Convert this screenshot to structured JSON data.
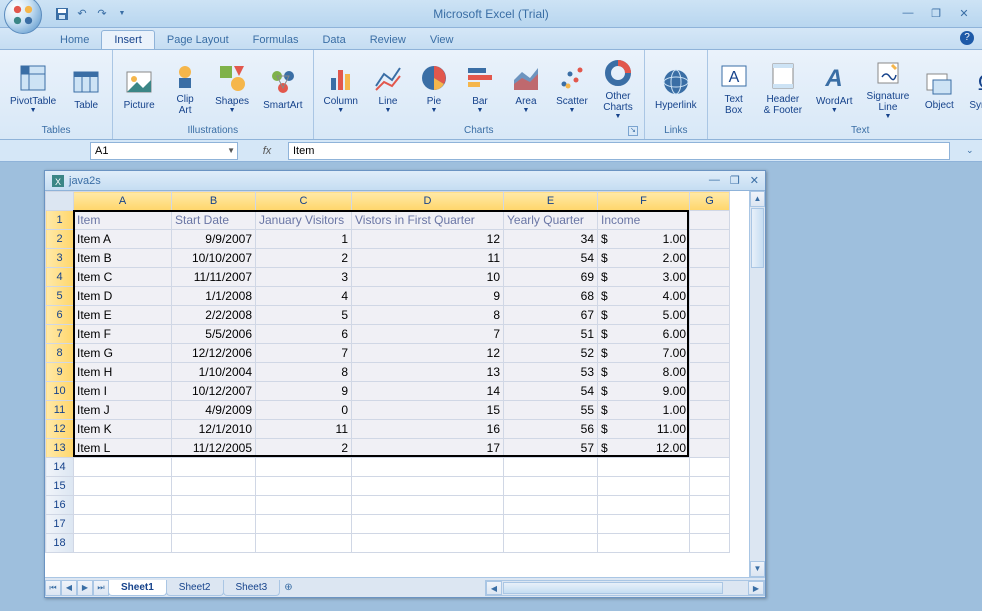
{
  "app": {
    "title": "Microsoft Excel (Trial)"
  },
  "qat": {
    "save": "save-icon",
    "undo": "undo-icon",
    "redo": "redo-icon"
  },
  "tabs": [
    "Home",
    "Insert",
    "Page Layout",
    "Formulas",
    "Data",
    "Review",
    "View"
  ],
  "active_tab": "Insert",
  "ribbon": {
    "groups": [
      {
        "label": "Tables",
        "items": [
          {
            "name": "pivottable",
            "label": "PivotTable",
            "dd": true
          },
          {
            "name": "table",
            "label": "Table"
          }
        ]
      },
      {
        "label": "Illustrations",
        "launcher": false,
        "items": [
          {
            "name": "picture",
            "label": "Picture"
          },
          {
            "name": "clipart",
            "label": "Clip\nArt"
          },
          {
            "name": "shapes",
            "label": "Shapes",
            "dd": true
          },
          {
            "name": "smartart",
            "label": "SmartArt"
          }
        ]
      },
      {
        "label": "Charts",
        "launcher": true,
        "items": [
          {
            "name": "column",
            "label": "Column",
            "dd": true
          },
          {
            "name": "line",
            "label": "Line",
            "dd": true
          },
          {
            "name": "pie",
            "label": "Pie",
            "dd": true
          },
          {
            "name": "bar",
            "label": "Bar",
            "dd": true
          },
          {
            "name": "area",
            "label": "Area",
            "dd": true
          },
          {
            "name": "scatter",
            "label": "Scatter",
            "dd": true
          },
          {
            "name": "othercharts",
            "label": "Other\nCharts",
            "dd": true
          }
        ]
      },
      {
        "label": "Links",
        "items": [
          {
            "name": "hyperlink",
            "label": "Hyperlink"
          }
        ]
      },
      {
        "label": "Text",
        "items": [
          {
            "name": "textbox",
            "label": "Text\nBox"
          },
          {
            "name": "headerfooter",
            "label": "Header\n& Footer"
          },
          {
            "name": "wordart",
            "label": "WordArt",
            "dd": true
          },
          {
            "name": "sigline",
            "label": "Signature\nLine",
            "dd": true
          },
          {
            "name": "object",
            "label": "Object"
          },
          {
            "name": "symbol",
            "label": "Symbol"
          }
        ]
      }
    ]
  },
  "namebox": "A1",
  "formula": "Item",
  "workbook": {
    "title": "java2s",
    "columns": [
      "A",
      "B",
      "C",
      "D",
      "E",
      "F",
      "G"
    ],
    "headers": [
      "Item",
      "Start Date",
      "January Visitors",
      "Vistors in First Quarter",
      "Yearly Quarter",
      "Income"
    ],
    "rows": [
      [
        "Item A",
        "9/9/2007",
        "1",
        "12",
        "34",
        "$",
        "1.00"
      ],
      [
        "Item B",
        "10/10/2007",
        "2",
        "11",
        "54",
        "$",
        "2.00"
      ],
      [
        "Item C",
        "11/11/2007",
        "3",
        "10",
        "69",
        "$",
        "3.00"
      ],
      [
        "Item D",
        "1/1/2008",
        "4",
        "9",
        "68",
        "$",
        "4.00"
      ],
      [
        "Item E",
        "2/2/2008",
        "5",
        "8",
        "67",
        "$",
        "5.00"
      ],
      [
        "Item F",
        "5/5/2006",
        "6",
        "7",
        "51",
        "$",
        "6.00"
      ],
      [
        "Item G",
        "12/12/2006",
        "7",
        "12",
        "52",
        "$",
        "7.00"
      ],
      [
        "Item H",
        "1/10/2004",
        "8",
        "13",
        "53",
        "$",
        "8.00"
      ],
      [
        "Item I",
        "10/12/2007",
        "9",
        "14",
        "54",
        "$",
        "9.00"
      ],
      [
        "Item J",
        "4/9/2009",
        "0",
        "15",
        "55",
        "$",
        "1.00"
      ],
      [
        "Item K",
        "12/1/2010",
        "11",
        "16",
        "56",
        "$",
        "11.00"
      ],
      [
        "Item L",
        "11/12/2005",
        "2",
        "17",
        "57",
        "$",
        "12.00"
      ]
    ],
    "sheets": [
      "Sheet1",
      "Sheet2",
      "Sheet3"
    ],
    "active_sheet": "Sheet1"
  }
}
